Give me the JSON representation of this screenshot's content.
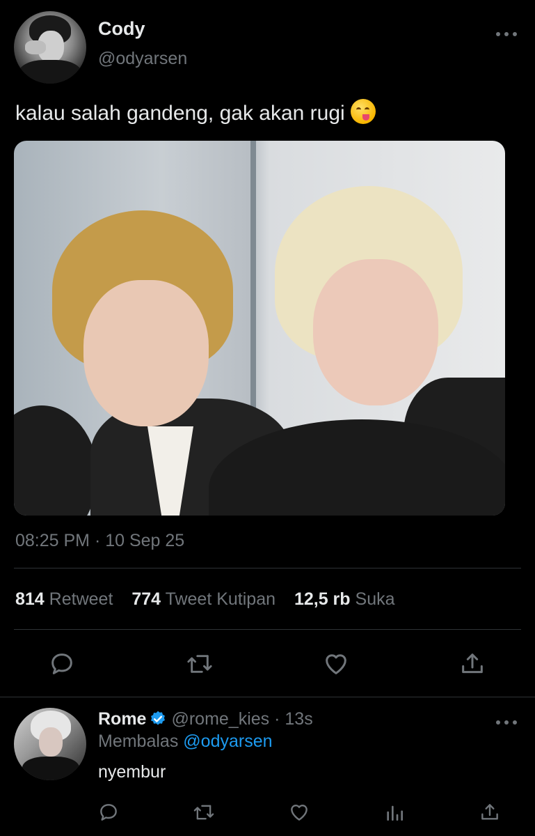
{
  "tweet": {
    "author_name": "Cody",
    "author_handle": "@odyarsen",
    "text": "kalau salah gandeng, gak akan rugi",
    "timestamp": "08:25 PM · 10 Sep 25",
    "stats": {
      "retweets_count": "814",
      "retweets_label": "Retweet",
      "quotes_count": "774",
      "quotes_label": "Tweet Kutipan",
      "likes_count": "12,5 rb",
      "likes_label": "Suka"
    },
    "more_icon": "more-dots-icon"
  },
  "reply": {
    "author_name": "Rome",
    "author_handle": "@rome_kies",
    "time": "· 13s",
    "replying_label": "Membalas",
    "replying_to": "@odyarsen",
    "text": "nyembur"
  },
  "colors": {
    "background": "#000000",
    "primary_text": "#e7e9ea",
    "secondary_text": "#71767b",
    "accent": "#1d9bf0",
    "divider": "#2f3336"
  }
}
